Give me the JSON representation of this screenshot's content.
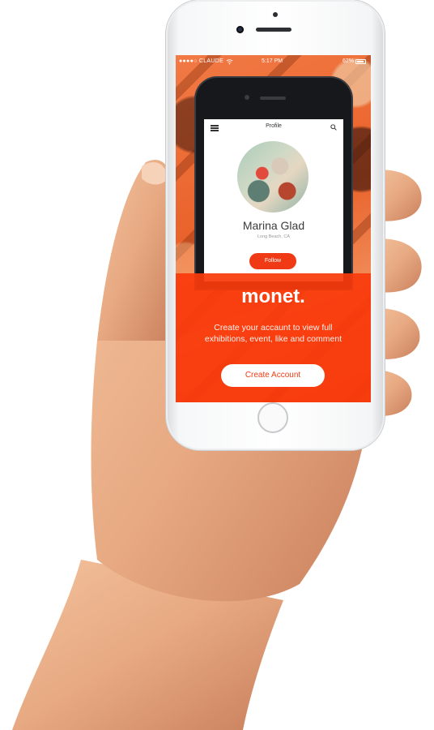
{
  "status_bar": {
    "carrier": "●●●●○ CLAUDE",
    "time": "5:17 PM",
    "battery": "62%"
  },
  "inner_app": {
    "header_title": "Profile",
    "user_name": "Marina Glad",
    "location": "Long Beach, CA",
    "follow_label": "Follow"
  },
  "overlay": {
    "brand": "monet.",
    "tagline": "Create your accaunt to view full exhibitions, event, like and comment",
    "create_account_label": "Create Account"
  },
  "colors": {
    "accent": "#f03a16",
    "overlay": "#fa3a0c"
  },
  "icons": [
    "menu-icon",
    "search-icon",
    "wifi-icon",
    "battery-icon"
  ]
}
